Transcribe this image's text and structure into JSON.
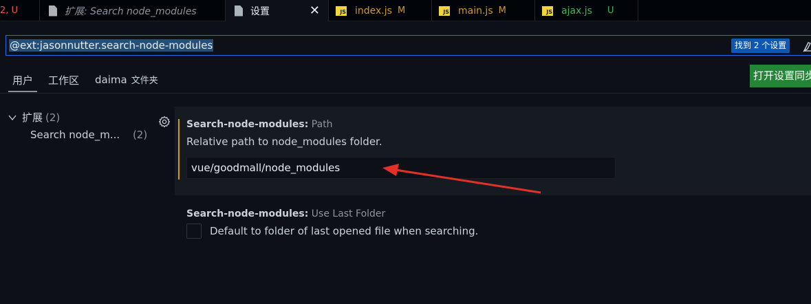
{
  "tabs": [
    {
      "label": "2, U",
      "status": "",
      "kind": "partial"
    },
    {
      "label": "扩展: Search node_modules",
      "status": "",
      "kind": "ext"
    },
    {
      "label": "设置",
      "status": "",
      "kind": "settings"
    },
    {
      "label": "index.js",
      "status": "M",
      "kind": "js"
    },
    {
      "label": "main.js",
      "status": "M",
      "kind": "js"
    },
    {
      "label": "ajax.js",
      "status": "U",
      "kind": "js"
    }
  ],
  "js_badge": "JS",
  "search": {
    "value": "@ext:jasonnutter.search-node-modules",
    "found": "找到 2 个设置"
  },
  "scopes": {
    "user": "用户",
    "workspace": "工作区",
    "folder": "daima",
    "folder_sub": "文件夹"
  },
  "sync_button": "打开设置同步",
  "tree": {
    "group_label": "扩展",
    "group_count": "(2)",
    "item_label": "Search node_m...",
    "item_count": "(2)"
  },
  "settings": {
    "path": {
      "category": "Search-node-modules:",
      "name": "Path",
      "description": "Relative path to node_modules folder.",
      "value": "vue/goodmall/node_modules"
    },
    "last_folder": {
      "category": "Search-node-modules:",
      "name": "Use Last Folder",
      "description": "Default to folder of last opened file when searching.",
      "checked": false
    }
  },
  "colors": {
    "accent": "#1f6feb",
    "modified": "#d29922",
    "untracked": "#3fb950",
    "sync": "#238636",
    "annotation": "#e5302a"
  }
}
